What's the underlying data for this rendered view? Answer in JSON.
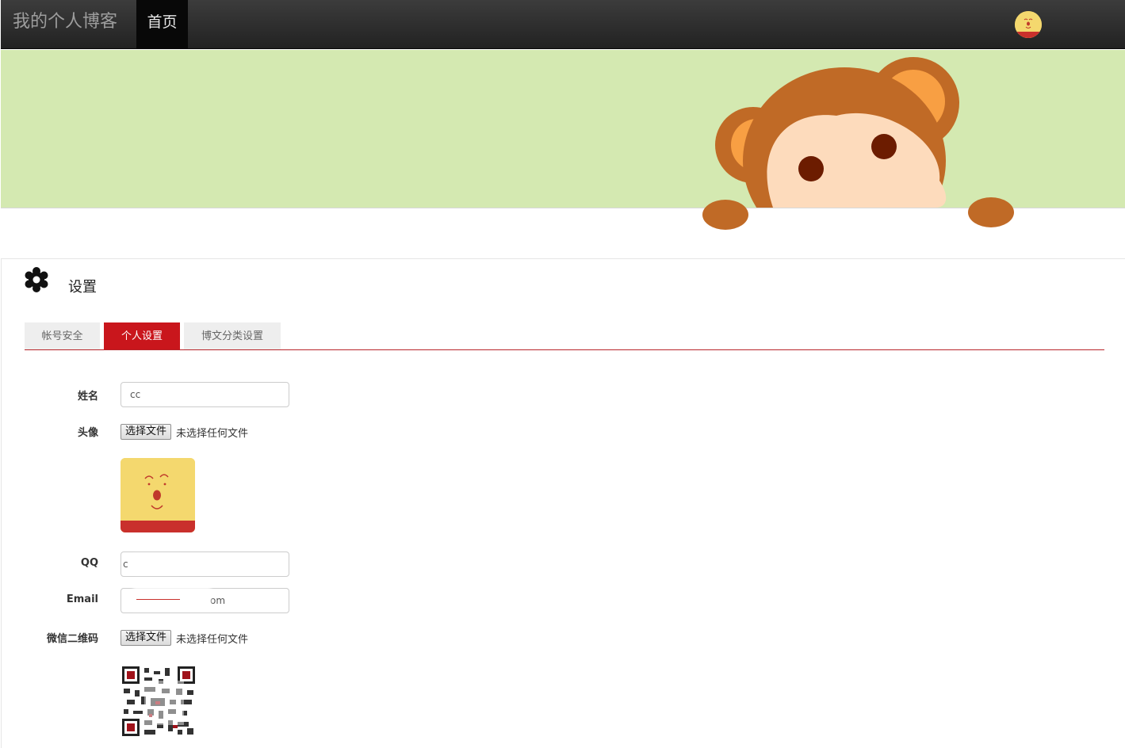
{
  "navbar": {
    "brand": "我的个人博客",
    "home": "首页"
  },
  "settings": {
    "title": "设置",
    "tabs": [
      {
        "label": "帐号安全",
        "active": false
      },
      {
        "label": "个人设置",
        "active": true
      },
      {
        "label": "博文分类设置",
        "active": false
      }
    ]
  },
  "form": {
    "name": {
      "label": "姓名",
      "value": "cc"
    },
    "avatar": {
      "label": "头像",
      "button": "选择文件",
      "note": "未选择任何文件"
    },
    "qq": {
      "label": "QQ",
      "value": "c"
    },
    "email": {
      "label": "Email",
      "value": "om"
    },
    "wechat": {
      "label": "微信二维码",
      "button": "选择文件",
      "note": "未选择任何文件"
    }
  },
  "colors": {
    "accent": "#c9161c",
    "banner": "#d4e9b1",
    "navbar": "#222222"
  }
}
